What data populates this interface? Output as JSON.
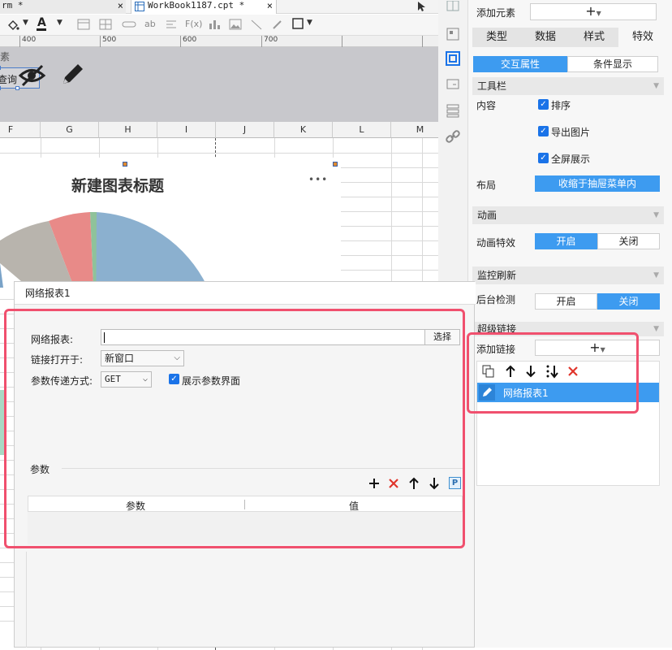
{
  "tabs": [
    {
      "label": "rm *",
      "close": "×"
    },
    {
      "label": "WorkBook1187.cpt *",
      "close": "×"
    }
  ],
  "ruler": [
    "400",
    "500",
    "600",
    "700"
  ],
  "form": {
    "element_label": "素",
    "query_button": "查询"
  },
  "sheet": {
    "columns": [
      "F",
      "G",
      "H",
      "I",
      "J",
      "K",
      "L",
      "M"
    ],
    "chart_title": "新建图表标题",
    "more": "•••"
  },
  "panel": {
    "add_element_label": "添加元素",
    "add_symbol": "+",
    "tabs": [
      "类型",
      "数据",
      "样式",
      "特效"
    ],
    "active_tab": "特效",
    "subtabs": [
      "交互属性",
      "条件显示"
    ],
    "toolbar_section": "工具栏",
    "content_label": "内容",
    "checkboxes": [
      "排序",
      "导出图片",
      "全屏展示"
    ],
    "layout_label": "布局",
    "layout_value": "收缩于抽屉菜单内",
    "animation_section": "动画",
    "animation_label": "动画特效",
    "on": "开启",
    "off": "关闭",
    "monitor_section": "监控刷新",
    "background_detect": "后台检测",
    "hyperlink_section": "超级链接",
    "add_link_label": "添加链接",
    "link_item": "网络报表1"
  },
  "dialog": {
    "title": "网络报表1",
    "report_label": "网络报表:",
    "report_value": "",
    "select_button": "选择",
    "open_in_label": "链接打开于:",
    "open_in_value": "新窗口",
    "param_method_label": "参数传递方式:",
    "param_method_value": "GET",
    "show_params_label": "展示参数界面",
    "params_section": "参数",
    "table_headers": [
      "参数",
      "值"
    ]
  },
  "colors": {
    "accent": "#3d9bf0",
    "highlight": "#f0506e",
    "delete": "#e0352b"
  }
}
